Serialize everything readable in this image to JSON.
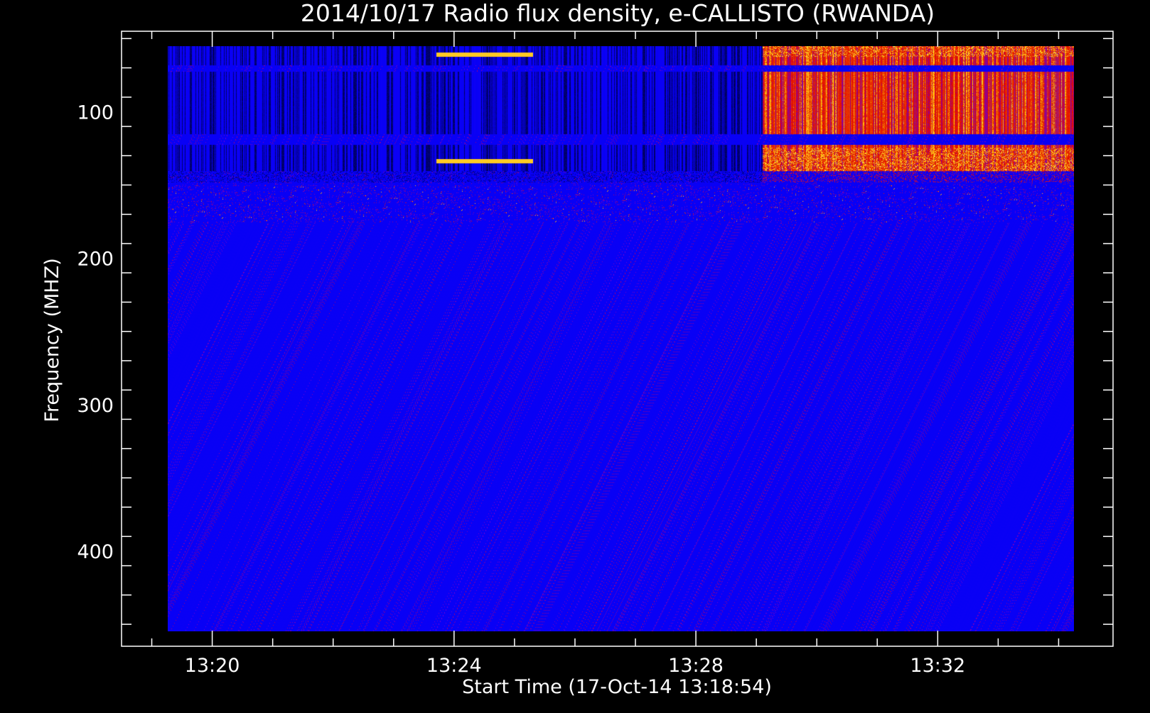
{
  "chart_data": {
    "type": "heatmap",
    "title": "2014/10/17  Radio flux density, e-CALLISTO (RWANDA)",
    "xlabel": "Start Time (17-Oct-14 13:18:54)",
    "ylabel": "Frequency (MHZ)",
    "x_ticks": [
      "13:20",
      "13:24",
      "13:28",
      "13:32"
    ],
    "x_tick_minutes": [
      20,
      24,
      28,
      32
    ],
    "xlim_minutes": [
      18.5,
      34.9
    ],
    "data_time_range_minutes": [
      19.27,
      34.25
    ],
    "y_ticks": [
      100,
      200,
      300,
      400
    ],
    "ylim": [
      45,
      465
    ],
    "data_freq_range": [
      55,
      455
    ],
    "y_reversed": true,
    "colormap": [
      "#000000",
      "#0000ff",
      "#cc0000",
      "#ff6000",
      "#ffff80"
    ],
    "colors": {
      "background": "#000000",
      "axes": "#ffffff",
      "baseline": "#0a0af5"
    },
    "features": [
      {
        "name": "interference band",
        "freq": [
          55,
          68
        ],
        "time": [
          19.27,
          34.25
        ],
        "level": "high"
      },
      {
        "name": "interference band",
        "freq": [
          72,
          115
        ],
        "time": [
          19.27,
          34.25
        ],
        "level": "high"
      },
      {
        "name": "interference band",
        "freq": [
          122,
          140
        ],
        "time": [
          19.27,
          34.25
        ],
        "level": "high"
      },
      {
        "name": "enhanced emission",
        "freq": [
          55,
          145
        ],
        "time": [
          29.1,
          34.25
        ],
        "level": "very high"
      },
      {
        "name": "narrowband line",
        "freq": [
          59,
          62
        ],
        "time": [
          23.7,
          25.3
        ],
        "level": "burst"
      },
      {
        "name": "narrowband line",
        "freq": [
          132,
          135
        ],
        "time": [
          23.7,
          25.3
        ],
        "level": "burst"
      },
      {
        "name": "spike cluster",
        "freq": [
          150,
          175
        ],
        "time": [
          19.3,
          34.2
        ],
        "level": "sparse"
      }
    ]
  }
}
